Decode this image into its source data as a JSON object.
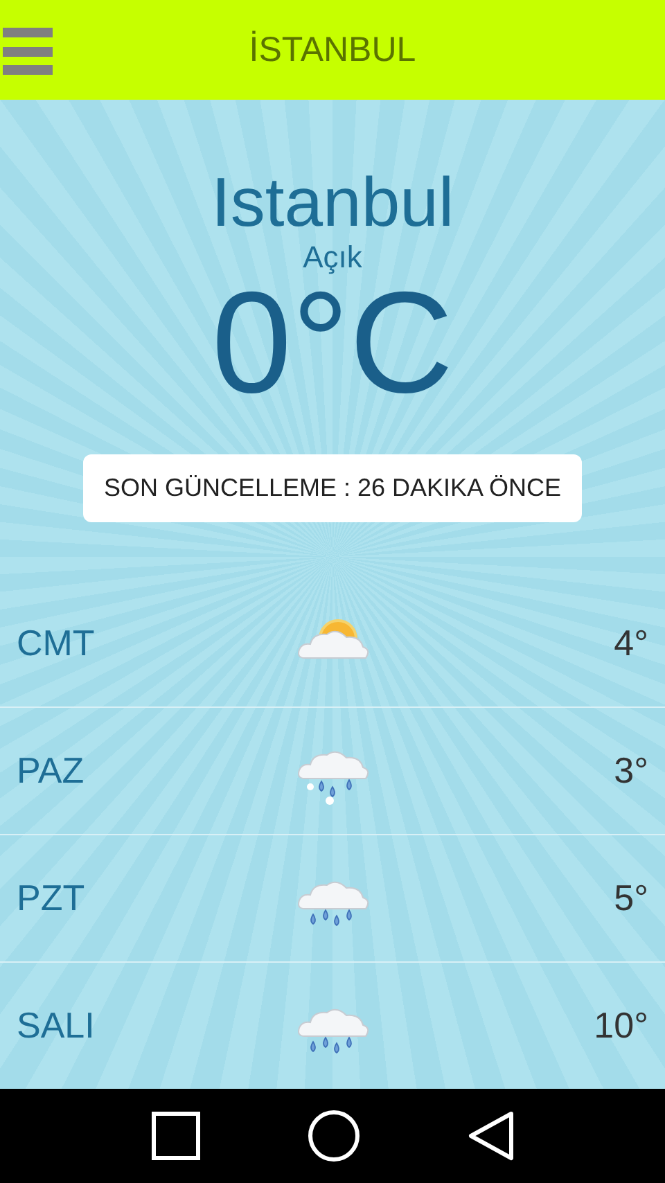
{
  "app_bar": {
    "title": "İSTANBUL"
  },
  "current": {
    "city": "Istanbul",
    "condition": "Açık",
    "temperature": "0°C"
  },
  "last_update": "SON GÜNCELLEME : 26 DAKIKA ÖNCE",
  "forecast": [
    {
      "day": "CMT",
      "kind": "partly-sunny",
      "temp": "4°"
    },
    {
      "day": "PAZ",
      "kind": "rain-snow",
      "temp": "3°"
    },
    {
      "day": "PZT",
      "kind": "rain",
      "temp": "5°"
    },
    {
      "day": "SALI",
      "kind": "rain",
      "temp": "10°"
    }
  ]
}
